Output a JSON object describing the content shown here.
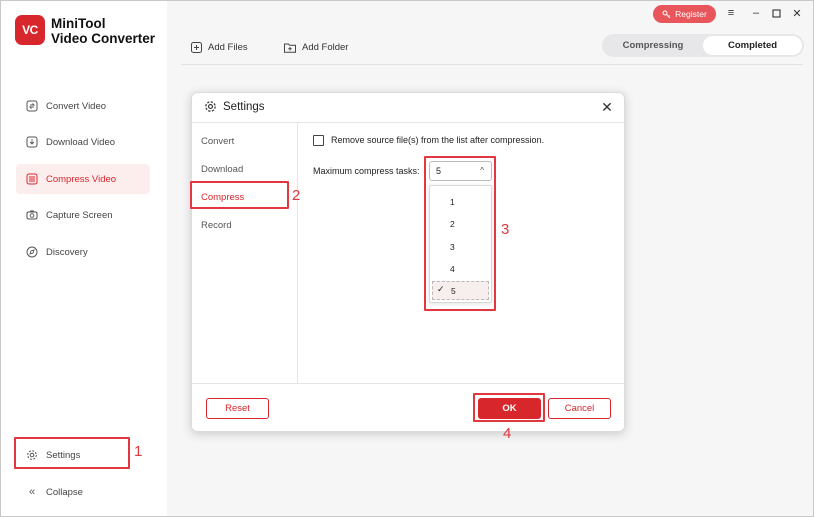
{
  "app": {
    "logo_text": "VC",
    "brand_line1": "MiniTool",
    "brand_line2": "Video Converter"
  },
  "sidebar": {
    "items": [
      {
        "label": "Convert Video",
        "icon": "convert-icon"
      },
      {
        "label": "Download Video",
        "icon": "download-icon"
      },
      {
        "label": "Compress Video",
        "icon": "compress-icon",
        "active": true
      },
      {
        "label": "Capture Screen",
        "icon": "camera-icon"
      },
      {
        "label": "Discovery",
        "icon": "compass-icon"
      }
    ],
    "settings_label": "Settings",
    "collapse_label": "Collapse"
  },
  "topbar": {
    "register_label": "Register"
  },
  "toolbar": {
    "add_files": "Add Files",
    "add_folder": "Add Folder"
  },
  "segment": {
    "compressing": "Compressing",
    "completed": "Completed",
    "selected": "Completed"
  },
  "dialog": {
    "title": "Settings",
    "tabs": [
      "Convert",
      "Download",
      "Compress",
      "Record"
    ],
    "active_tab": "Compress",
    "remove_source_label": "Remove source file(s) from the list after compression.",
    "remove_source_checked": false,
    "max_tasks_label": "Maximum compress tasks:",
    "max_tasks_value": "5",
    "options": [
      "1",
      "2",
      "3",
      "4",
      "5"
    ],
    "reset_label": "Reset",
    "ok_label": "OK",
    "cancel_label": "Cancel"
  },
  "annotations": {
    "n1": "1",
    "n2": "2",
    "n3": "3",
    "n4": "4"
  },
  "colors": {
    "accent": "#d8262d",
    "highlight": "#e0383e",
    "active_bg": "#fdeeee"
  }
}
